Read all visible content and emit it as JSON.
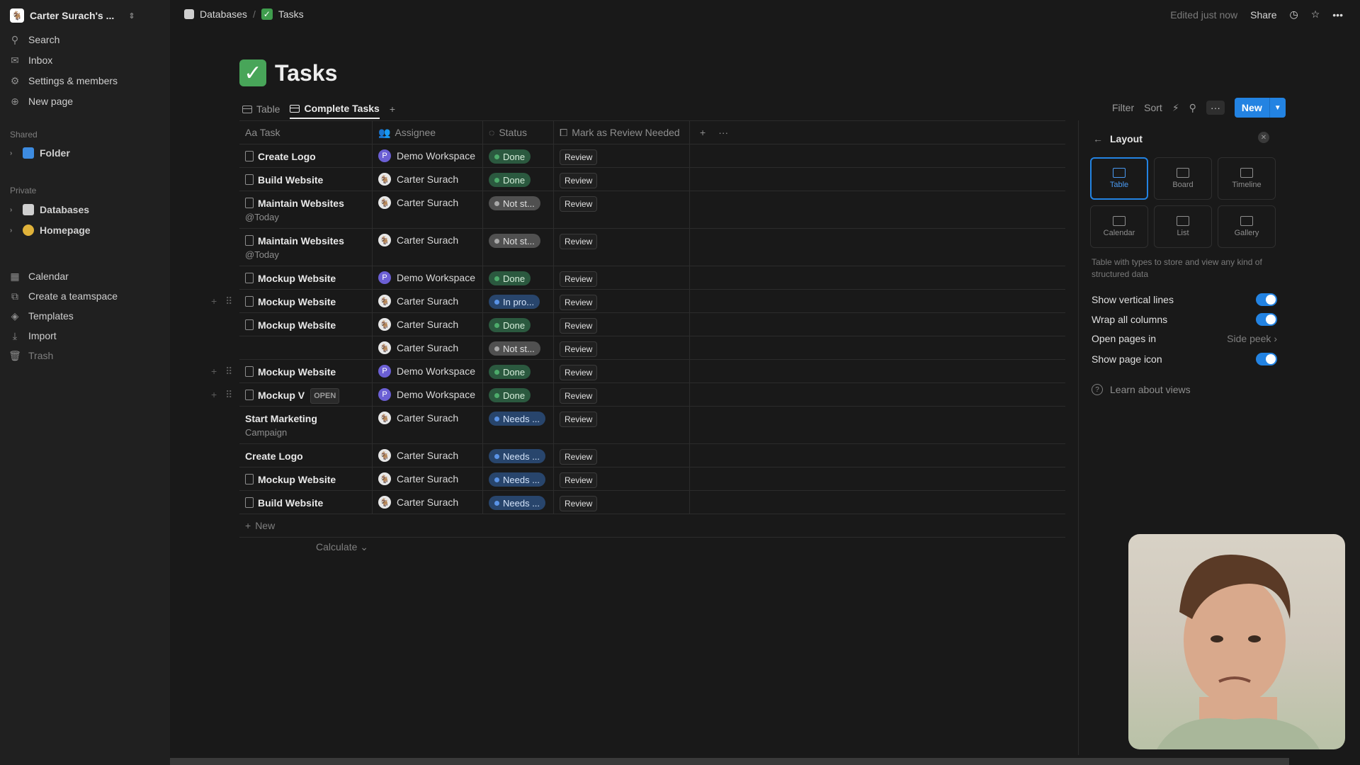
{
  "workspace": {
    "name": "Carter Surach's ...",
    "avatar": "🐐"
  },
  "nav": {
    "search": "Search",
    "inbox": "Inbox",
    "settings": "Settings & members",
    "new_page": "New page",
    "shared_label": "Shared",
    "shared_items": [
      {
        "label": "Folder"
      }
    ],
    "private_label": "Private",
    "private_items": [
      {
        "label": "Databases"
      },
      {
        "label": "Homepage"
      }
    ],
    "bottom": {
      "calendar": "Calendar",
      "teamspace": "Create a teamspace",
      "templates": "Templates",
      "import": "Import",
      "trash": "Trash"
    }
  },
  "breadcrumb": {
    "databases": "Databases",
    "sep": "/",
    "tasks": "Tasks"
  },
  "topbar": {
    "edited": "Edited just now",
    "share": "Share"
  },
  "page": {
    "title": "Tasks"
  },
  "tabs": [
    {
      "label": "Table"
    },
    {
      "label": "Complete Tasks"
    }
  ],
  "toolbar": {
    "filter": "Filter",
    "sort": "Sort",
    "more": "···",
    "new": "New"
  },
  "table": {
    "headers": {
      "task": "Aa Task",
      "assignee": "Assignee",
      "status": "Status",
      "review": "Mark as Review Needed"
    },
    "rows": [
      {
        "task": "Create Logo",
        "sub": "",
        "assignee": "Demo Workspace",
        "status": "Done",
        "btn": "Review"
      },
      {
        "task": "Build Website",
        "sub": "",
        "assignee": "Carter Surach",
        "status": "Done",
        "btn": "Review"
      },
      {
        "task": "Maintain Websites",
        "sub": "@Today",
        "assignee": "Carter Surach",
        "status": "Not st...",
        "btn": "Review"
      },
      {
        "task": "Maintain Websites",
        "sub": "@Today",
        "assignee": "Carter Surach",
        "status": "Not st...",
        "btn": "Review"
      },
      {
        "task": "Mockup Website",
        "sub": "",
        "assignee": "Demo Workspace",
        "status": "Done",
        "btn": "Review"
      },
      {
        "task": "Mockup Website",
        "sub": "",
        "assignee": "Carter Surach",
        "status": "In pro...",
        "btn": "Review"
      },
      {
        "task": "Mockup Website",
        "sub": "",
        "assignee": "Carter Surach",
        "status": "Done",
        "btn": "Review"
      },
      {
        "task": "",
        "sub": "",
        "assignee": "Carter Surach",
        "status": "Not st...",
        "btn": "Review"
      },
      {
        "task": "Mockup Website",
        "sub": "",
        "assignee": "Demo Workspace",
        "status": "Done",
        "btn": "Review"
      },
      {
        "task": "Mockup V",
        "open": "OPEN",
        "sub": "",
        "assignee": "Demo Workspace",
        "status": "Done",
        "btn": "Review"
      },
      {
        "task": "Start Marketing",
        "sub": "Campaign",
        "assignee": "Carter Surach",
        "status": "Needs ...",
        "btn": "Review"
      },
      {
        "task": "Create Logo",
        "sub": "",
        "assignee": "Carter Surach",
        "status": "Needs ...",
        "btn": "Review"
      },
      {
        "task": "Mockup Website",
        "sub": "",
        "assignee": "Carter Surach",
        "status": "Needs ...",
        "btn": "Review"
      },
      {
        "task": "Build Website",
        "sub": "",
        "assignee": "Carter Surach",
        "status": "Needs ...",
        "btn": "Review"
      }
    ],
    "new_label": "New",
    "calculate": "Calculate"
  },
  "layout_panel": {
    "title": "Layout",
    "options": [
      {
        "label": "Table"
      },
      {
        "label": "Board"
      },
      {
        "label": "Timeline"
      },
      {
        "label": "Calendar"
      },
      {
        "label": "List"
      },
      {
        "label": "Gallery"
      }
    ],
    "description": "Table with types to store and view any kind of structured data",
    "show_vertical_lines": "Show vertical lines",
    "wrap_all_columns": "Wrap all columns",
    "open_pages_in": "Open pages in",
    "open_pages_value": "Side peek",
    "show_page_icon": "Show page icon",
    "learn": "Learn about views"
  },
  "colors": {
    "accent": "#2383e2",
    "done": "#4dab6b",
    "progress": "#5a93e6",
    "not_started": "#a8a8a8"
  }
}
